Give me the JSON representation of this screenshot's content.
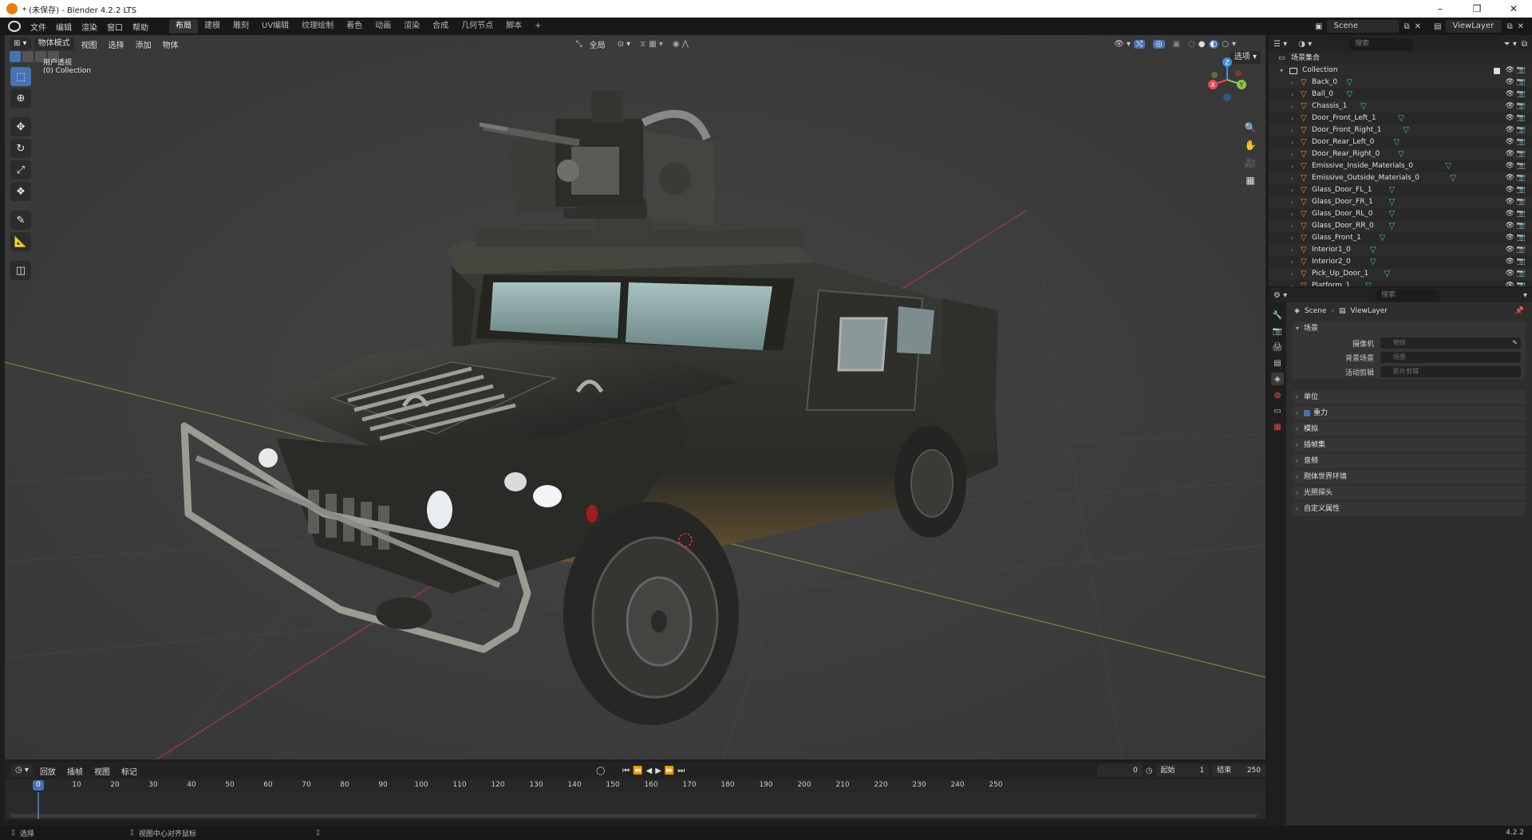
{
  "window": {
    "title": "* (未保存) - Blender 4.2.2 LTS",
    "controls": [
      "–",
      "❐",
      "✕"
    ]
  },
  "menu": [
    "文件",
    "编辑",
    "渲染",
    "窗口",
    "帮助"
  ],
  "workspaces": [
    "布局",
    "建模",
    "雕刻",
    "UV编辑",
    "纹理绘制",
    "着色",
    "动画",
    "渲染",
    "合成",
    "几何节点",
    "脚本",
    "+"
  ],
  "active_workspace": "布局",
  "scene_selector": "Scene",
  "viewlayer_selector": "ViewLayer",
  "viewport": {
    "mode": "物体模式",
    "menus": [
      "视图",
      "选择",
      "添加",
      "物体"
    ],
    "transform_orientation": "全局",
    "options_label": "选项",
    "view_name": "用户透视",
    "collection_label": "(0) Collection"
  },
  "gizmo": {
    "x": "X",
    "y": "Y",
    "z": "Z"
  },
  "outliner": {
    "search_placeholder": "搜索",
    "root": "场景集合",
    "collection": "Collection",
    "objects": [
      "Back_0",
      "Ball_0",
      "Chassis_1",
      "Door_Front_Left_1",
      "Door_Front_Right_1",
      "Door_Rear_Left_0",
      "Door_Rear_Right_0",
      "Emissive_Inside_Materials_0",
      "Emissive_Outside_Materials_0",
      "Glass_Door_FL_1",
      "Glass_Door_FR_1",
      "Glass_Door_RL_0",
      "Glass_Door_RR_0",
      "Glass_Front_1",
      "Interior1_0",
      "Interior2_0",
      "Pick_Up_Door_1",
      "Platform_1"
    ]
  },
  "properties": {
    "search_placeholder": "搜索",
    "breadcrumb_scene": "Scene",
    "breadcrumb_viewlayer": "ViewLayer",
    "scene_panel": "场景",
    "fields": [
      {
        "label": "摄像机",
        "placeholder": "物体"
      },
      {
        "label": "背景场景",
        "placeholder": "场景"
      },
      {
        "label": "活动剪辑",
        "placeholder": "影片剪辑"
      }
    ],
    "panels": [
      "单位",
      "重力",
      "模拟",
      "插帧集",
      "音频",
      "刚体世界环境",
      "光照探头",
      "自定义属性"
    ],
    "gravity_checked": true
  },
  "timeline": {
    "menus": [
      "回放",
      "插帧",
      "视图",
      "标记"
    ],
    "current_frame": "0",
    "start_label": "起始",
    "start": "1",
    "end_label": "结束",
    "end": "250",
    "ticks": [
      "0",
      "10",
      "20",
      "30",
      "40",
      "50",
      "60",
      "70",
      "80",
      "90",
      "100",
      "110",
      "120",
      "130",
      "140",
      "150",
      "160",
      "170",
      "180",
      "190",
      "200",
      "210",
      "220",
      "230",
      "240",
      "250"
    ],
    "playhead_frame": 0
  },
  "statusbar": {
    "select": "选择",
    "center_view": "视图中心对齐鼠标",
    "version": "4.2.2"
  },
  "colors": {
    "accent": "#4772b3",
    "object_icon": "#e58e42",
    "mesh_icon": "#3fc6a0",
    "axis_x": "#e94b54",
    "axis_y": "#8bc34a",
    "axis_z": "#3f8fe0"
  }
}
